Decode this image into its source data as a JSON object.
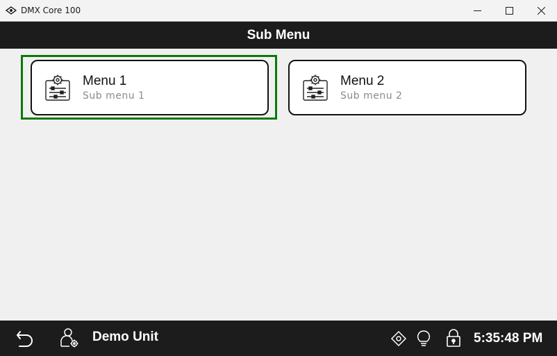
{
  "window": {
    "title": "DMX Core 100",
    "controls": [
      "minimize-icon",
      "maximize-icon",
      "close-icon"
    ]
  },
  "header": {
    "title": "Sub Menu"
  },
  "menus": [
    {
      "title": "Menu 1",
      "subtitle": "Sub menu 1",
      "icon": "settings-clipboard-icon",
      "selected": true
    },
    {
      "title": "Menu 2",
      "subtitle": "Sub menu 2",
      "icon": "settings-clipboard-icon",
      "selected": false
    }
  ],
  "bottombar": {
    "unit_name": "Demo Unit",
    "time": "5:35:48 PM",
    "icons": [
      "back-icon",
      "user-settings-icon",
      "locate-icon",
      "lightbulb-icon",
      "lock-icon"
    ]
  },
  "colors": {
    "bar_background": "#1c1c1c",
    "focus": "#0a7a0a",
    "background": "#f0f0f0"
  }
}
